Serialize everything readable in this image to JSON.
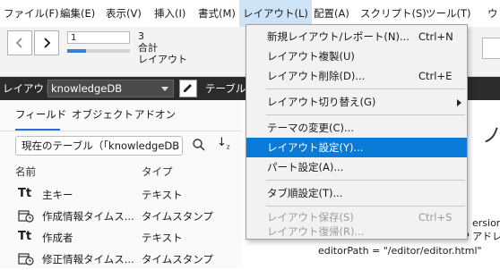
{
  "menubar": {
    "items": [
      "ファイル(F)",
      "編集(E)",
      "表示(V)",
      "挿入(I)",
      "書式(M)",
      "レイアウト(L)",
      "配置(A)",
      "スクリプト(S)",
      "ツール(T)",
      "ウ"
    ]
  },
  "toolbar": {
    "record_input": "1",
    "record_progress": 0.3,
    "record_count": "3",
    "record_total_label": "合計",
    "layout_label": "レイアウト"
  },
  "layoutbar": {
    "label": "レイアウト:",
    "selected_layout": "knowledgeDB",
    "table_label": "テーブル"
  },
  "sidebar": {
    "tabs": [
      "フィールド",
      "オブジェクト",
      "アドオン"
    ],
    "table_select": "現在のテーブル（「knowledgeDB",
    "columns": {
      "name": "名前",
      "type": "タイプ"
    },
    "fields": [
      {
        "icon": "text-icon",
        "name": "主キー",
        "type": "テキスト"
      },
      {
        "icon": "timestamp-icon",
        "name": "作成情報タイムス...",
        "type": "タイムスタンプ"
      },
      {
        "icon": "text-icon",
        "name": "作成者",
        "type": "テキスト"
      },
      {
        "icon": "timestamp-icon",
        "name": "修正情報タイムス...",
        "type": "タイムスタンプ"
      }
    ]
  },
  "content": {
    "big_char": "ノ",
    "lines": [
      "ersion",
      "P アドレ",
      "editorPath = \"/editor/editor.html\""
    ]
  },
  "dropdown": {
    "items": [
      {
        "label": "新規レイアウト/レポート(N)...",
        "shortcut": "Ctrl+N",
        "disabled": false
      },
      {
        "label": "レイアウト複製(U)",
        "shortcut": "",
        "disabled": false
      },
      {
        "label": "レイアウト削除(D)...",
        "shortcut": "Ctrl+E",
        "disabled": false
      },
      {
        "label": "レイアウト切り替え(G)",
        "shortcut": "",
        "disabled": false,
        "submenu": true
      },
      {
        "label": "テーマの変更(C)...",
        "shortcut": "",
        "disabled": false
      },
      {
        "label": "レイアウト設定(Y)...",
        "shortcut": "",
        "disabled": false,
        "highlighted": true
      },
      {
        "label": "パート設定(A)...",
        "shortcut": "",
        "disabled": false
      },
      {
        "label": "タブ順設定(T)...",
        "shortcut": "",
        "disabled": false
      },
      {
        "label": "レイアウト保存(S)",
        "shortcut": "Ctrl+S",
        "disabled": true
      },
      {
        "label": "レイアウト復帰(R)...",
        "shortcut": "",
        "disabled": true
      }
    ]
  },
  "colors": {
    "highlight": "#0a7ad8",
    "accent": "#2a6fd6",
    "layoutbar": "#2b2b2b"
  }
}
